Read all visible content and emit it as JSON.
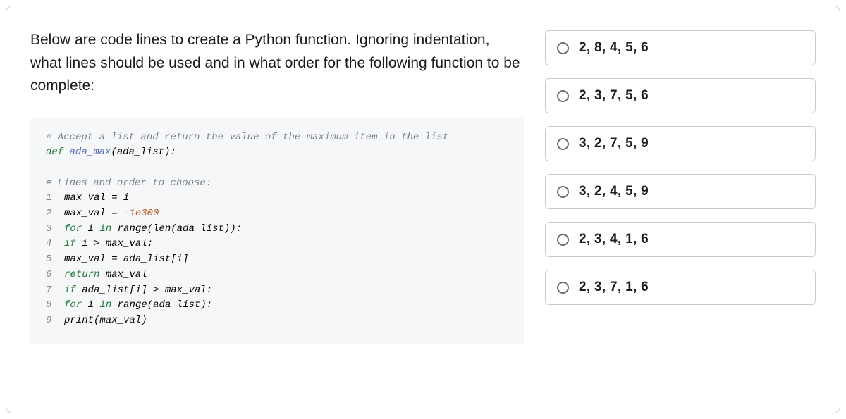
{
  "question": "Below are code lines to create a Python function. Ignoring indentation, what lines should be used and in what order for the following function to be complete:",
  "code": {
    "comment1": "# Accept a list and return the value of the maximum item in the list",
    "def_kw": "def",
    "fn_name": "ada_max",
    "def_rest": "(ada_list):",
    "comment2": "# Lines and order to choose:",
    "lines": [
      {
        "n": "1",
        "plain": "max_val = i"
      },
      {
        "n": "2",
        "plain": "max_val = ",
        "lit": "-1e300"
      },
      {
        "n": "3",
        "kw": "for",
        "mid": " i ",
        "kw2": "in",
        "rest": " range(len(ada_list)):"
      },
      {
        "n": "4",
        "kw": "if",
        "rest": " i > max_val:"
      },
      {
        "n": "5",
        "plain": "max_val = ada_list[i]"
      },
      {
        "n": "6",
        "kw": "return",
        "rest": " max_val"
      },
      {
        "n": "7",
        "kw": "if",
        "rest": " ada_list[i] > max_val:"
      },
      {
        "n": "8",
        "kw": "for",
        "mid": " i ",
        "kw2": "in",
        "rest": " range(ada_list):"
      },
      {
        "n": "9",
        "plain": "print(max_val)"
      }
    ]
  },
  "options": [
    "2, 8, 4, 5, 6",
    "2, 3, 7, 5, 6",
    "3, 2, 7, 5, 9",
    "3, 2, 4, 5, 9",
    "2, 3, 4, 1, 6",
    "2, 3, 7, 1, 6"
  ]
}
